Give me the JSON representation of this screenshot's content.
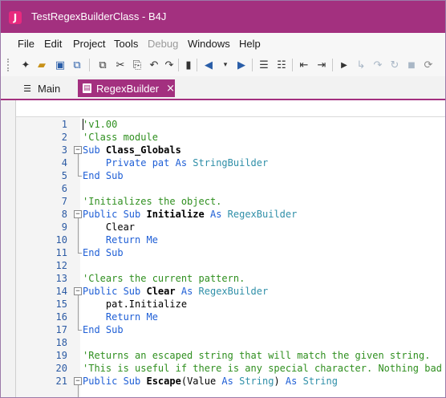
{
  "window": {
    "title": "TestRegexBuilderClass - B4J",
    "app_icon": "J"
  },
  "menu": [
    {
      "label": "File",
      "enabled": true
    },
    {
      "label": "Edit",
      "enabled": true
    },
    {
      "label": "Project",
      "enabled": true
    },
    {
      "label": "Tools",
      "enabled": true
    },
    {
      "label": "Debug",
      "enabled": false
    },
    {
      "label": "Windows",
      "enabled": true
    },
    {
      "label": "Help",
      "enabled": true
    }
  ],
  "toolbar": [
    "new-file-icon",
    "open-folder-icon",
    "save-icon",
    "save-all-icon",
    "copy-icon",
    "cut-icon",
    "paste-icon",
    "undo-icon",
    "redo-icon",
    "bookmark-icon",
    "navigate-back-icon",
    "navigate-forward-icon",
    "comment-icon",
    "uncomment-icon",
    "outdent-icon",
    "indent-icon",
    "run-icon",
    "step-in-icon",
    "step-over-icon",
    "step-out-icon",
    "stop-icon"
  ],
  "tabs": [
    {
      "label": "Main",
      "active": false
    },
    {
      "label": "RegexBuilder",
      "active": true,
      "close": "×"
    }
  ],
  "editor": {
    "lines": [
      {
        "n": "1",
        "parts": [
          [
            "cm",
            "'v1.00"
          ]
        ]
      },
      {
        "n": "2",
        "parts": [
          [
            "cm",
            "'Class module"
          ]
        ]
      },
      {
        "n": "3",
        "parts": [
          [
            "kw",
            "Sub "
          ],
          [
            "bd",
            "Class_Globals"
          ]
        ]
      },
      {
        "n": "4",
        "parts": [
          [
            "tx",
            "    "
          ],
          [
            "kw",
            "Private "
          ],
          [
            "kw",
            "pat "
          ],
          [
            "kw",
            "As "
          ],
          [
            "ty",
            "StringBuilder"
          ]
        ]
      },
      {
        "n": "5",
        "parts": [
          [
            "kw",
            "End Sub"
          ]
        ]
      },
      {
        "n": "6",
        "parts": []
      },
      {
        "n": "7",
        "parts": [
          [
            "cm",
            "'Initializes the object."
          ]
        ]
      },
      {
        "n": "8",
        "parts": [
          [
            "kw",
            "Public Sub "
          ],
          [
            "bd",
            "Initialize "
          ],
          [
            "kw",
            "As "
          ],
          [
            "ty",
            "RegexBuilder"
          ]
        ]
      },
      {
        "n": "9",
        "parts": [
          [
            "tx",
            "    Clear"
          ]
        ]
      },
      {
        "n": "10",
        "parts": [
          [
            "tx",
            "    "
          ],
          [
            "kw",
            "Return Me"
          ]
        ]
      },
      {
        "n": "11",
        "parts": [
          [
            "kw",
            "End Sub"
          ]
        ]
      },
      {
        "n": "12",
        "parts": []
      },
      {
        "n": "13",
        "parts": [
          [
            "cm",
            "'Clears the current pattern."
          ]
        ]
      },
      {
        "n": "14",
        "parts": [
          [
            "kw",
            "Public Sub "
          ],
          [
            "bd",
            "Clear "
          ],
          [
            "kw",
            "As "
          ],
          [
            "ty",
            "RegexBuilder"
          ]
        ]
      },
      {
        "n": "15",
        "parts": [
          [
            "tx",
            "    pat.Initialize"
          ]
        ]
      },
      {
        "n": "16",
        "parts": [
          [
            "tx",
            "    "
          ],
          [
            "kw",
            "Return Me"
          ]
        ]
      },
      {
        "n": "17",
        "parts": [
          [
            "kw",
            "End Sub"
          ]
        ]
      },
      {
        "n": "18",
        "parts": []
      },
      {
        "n": "19",
        "parts": [
          [
            "cm",
            "'Returns an escaped string that will match the given string."
          ]
        ]
      },
      {
        "n": "20",
        "parts": [
          [
            "cm",
            "'This is useful if there is any special character. Nothing bad"
          ]
        ]
      },
      {
        "n": "21",
        "parts": [
          [
            "kw",
            "Public Sub "
          ],
          [
            "bd",
            "Escape"
          ],
          [
            "tx",
            "(Value "
          ],
          [
            "kw",
            "As "
          ],
          [
            "ty",
            "String"
          ],
          [
            "tx",
            ") "
          ],
          [
            "kw",
            "As "
          ],
          [
            "ty",
            "String"
          ]
        ]
      }
    ]
  },
  "colors": {
    "accent": "#a3307f",
    "keyword": "#1f5fd6",
    "comment": "#2f8f1f",
    "type": "#2f8fa8"
  }
}
